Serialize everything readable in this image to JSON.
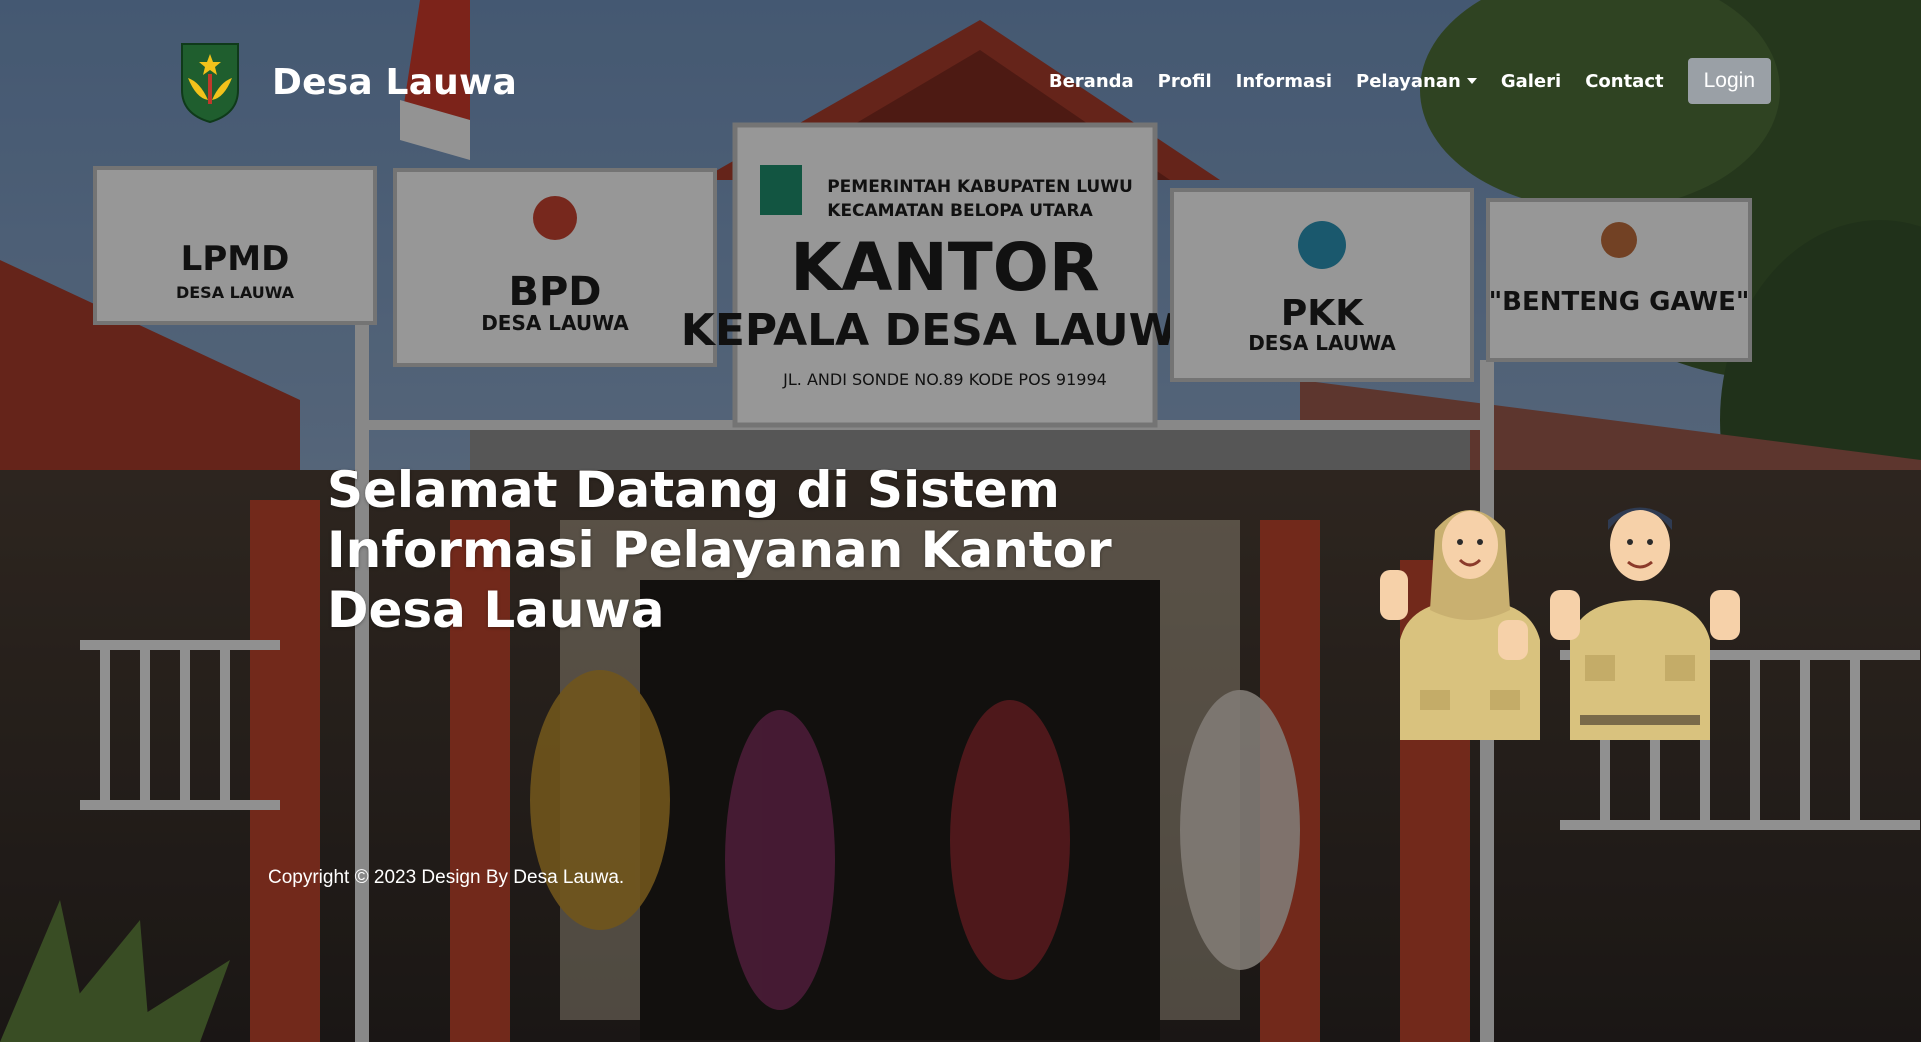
{
  "brand": {
    "name": "Desa Lauwa",
    "logo_icon": "desa-emblem-icon"
  },
  "nav": {
    "items": [
      {
        "label": "Beranda"
      },
      {
        "label": "Profil"
      },
      {
        "label": "Informasi"
      },
      {
        "label": "Pelayanan",
        "has_dropdown": true
      },
      {
        "label": "Galeri"
      },
      {
        "label": "Contact"
      }
    ],
    "login_label": "Login"
  },
  "hero": {
    "title": "Selamat Datang di Sistem Informasi Pelayanan Kantor Desa Lauwa",
    "background_photo": "kantor-kepala-desa-lauwa-photo",
    "illustration": "village-staff-illustration"
  },
  "footer": {
    "copyright": "Copyright © 2023 Design By Desa Lauwa."
  },
  "photo_signs": {
    "sign1": {
      "line1": "LPMD",
      "line2": "DESA LAUWA"
    },
    "sign2": {
      "line1": "BPD",
      "line2": "DESA LAUWA"
    },
    "sign3": {
      "line1": "PEMERINTAH KABUPATEN LUWU",
      "line2": "KECAMATAN BELOPA UTARA",
      "line3": "KANTOR",
      "line4": "KEPALA DESA LAUWA",
      "line5": "JL. ANDI SONDE NO.89 KODE POS 91994"
    },
    "sign4": {
      "line1": "PKK",
      "line2": "DESA LAUWA"
    },
    "sign5": {
      "line1": "\"BENTENG GAWE\""
    }
  },
  "colors": {
    "overlay": "#000000",
    "login_bg": "#9aa0a6",
    "text": "#ffffff",
    "uniform": "#d9c27e",
    "roof": "#a33a2a",
    "sky": "#5b7ea8"
  }
}
